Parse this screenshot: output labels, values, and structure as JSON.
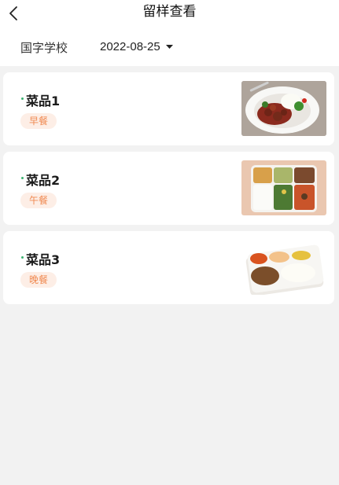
{
  "header": {
    "title": "留样查看",
    "back_icon": "chevron-left-icon"
  },
  "filter": {
    "school": "国字学校",
    "date": "2022-08-25",
    "dropdown_icon": "caret-down-icon"
  },
  "accent": {
    "dot": "#3cb371",
    "badge_text": "#f08a52",
    "badge_bg": "#fdeee6"
  },
  "samples": [
    {
      "name": "菜品1",
      "meal": "早餐",
      "image": "plate-of-stir-fry-with-rice"
    },
    {
      "name": "菜品2",
      "meal": "午餐",
      "image": "six-compartment-lunch-box"
    },
    {
      "name": "菜品3",
      "meal": "晚餐",
      "image": "takeout-meal-box-with-rice"
    }
  ]
}
